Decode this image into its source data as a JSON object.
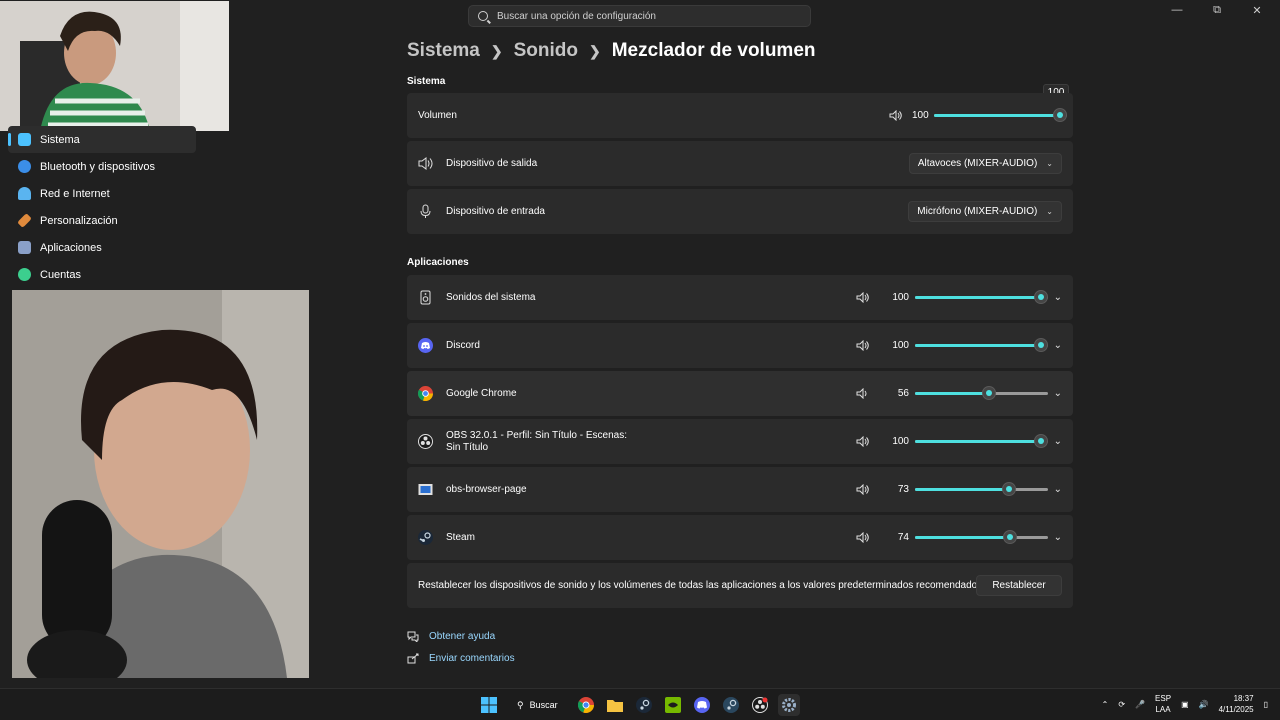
{
  "window": {
    "minimize": "—",
    "maximize": "⧉",
    "close": "✕"
  },
  "search": {
    "placeholder": "Buscar una opción de configuración"
  },
  "breadcrumb": {
    "item1": "Sistema",
    "item2": "Sonido",
    "current": "Mezclador de volumen"
  },
  "sidebar": {
    "items": [
      {
        "label": "Sistema",
        "color": "#4cc2ff"
      },
      {
        "label": "Bluetooth y dispositivos",
        "color": "#3b8ee8"
      },
      {
        "label": "Red e Internet",
        "color": "#5ab4f0"
      },
      {
        "label": "Personalización",
        "color": "#e08a3c"
      },
      {
        "label": "Aplicaciones",
        "color": "#8aa0c8"
      },
      {
        "label": "Cuentas",
        "color": "#3ccf8e"
      }
    ]
  },
  "sistema": {
    "section_title": "Sistema",
    "volume": {
      "label": "Volumen",
      "value": "100",
      "level": 1.0,
      "tooltip": "100"
    },
    "output": {
      "label": "Dispositivo de salida",
      "selected": "Altavoces (MIXER-AUDIO)"
    },
    "input": {
      "label": "Dispositivo de entrada",
      "selected": "Micrófono (MIXER-AUDIO)"
    }
  },
  "apps": {
    "section_title": "Aplicaciones",
    "list": [
      {
        "label": "Sonidos del sistema",
        "value": "100",
        "level": 1.0
      },
      {
        "label": "Discord",
        "value": "100",
        "level": 1.0
      },
      {
        "label": "Google Chrome",
        "value": "56",
        "level": 0.56
      },
      {
        "label": "OBS 32.0.1 - Perfil: Sin Título - Escenas: Sin Título",
        "value": "100",
        "level": 1.0
      },
      {
        "label": "obs-browser-page",
        "value": "73",
        "level": 0.73
      },
      {
        "label": "Steam",
        "value": "74",
        "level": 0.74
      }
    ]
  },
  "reset": {
    "text": "Restablecer los dispositivos de sonido y los volúmenes de todas las aplicaciones a los valores predeterminados recomendados",
    "button": "Restablecer"
  },
  "links": {
    "help": "Obtener ayuda",
    "feedback": "Enviar comentarios"
  },
  "taskbar": {
    "search_label": "Buscar",
    "lang1": "ESP",
    "lang2": "LAA",
    "time": "18:37",
    "date": "4/11/2025"
  },
  "colors": {
    "accent": "#4ee0e0",
    "background": "#202020",
    "card": "#2b2b2b"
  }
}
